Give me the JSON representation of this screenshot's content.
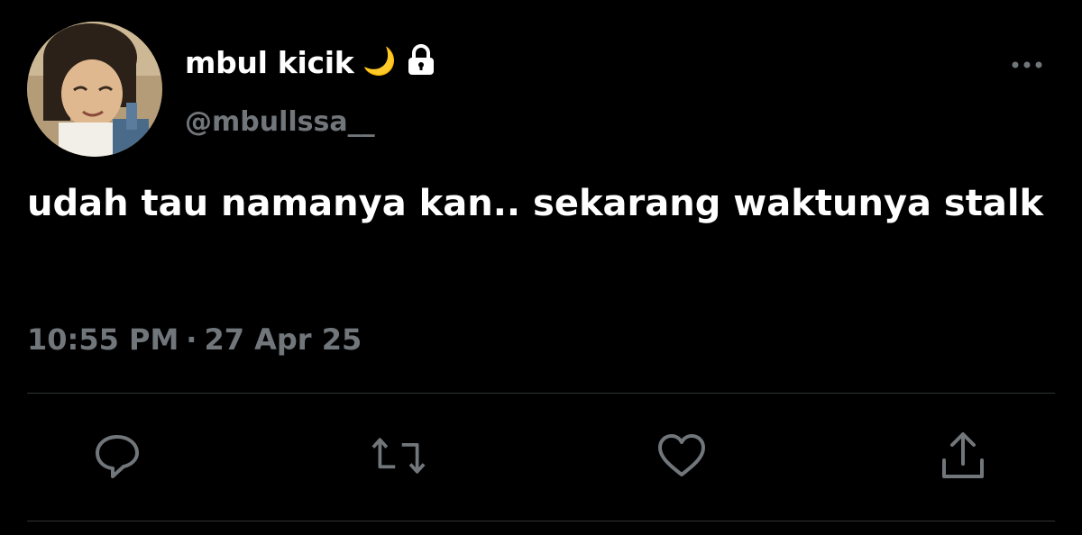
{
  "user": {
    "display_name": "mbul kicik",
    "handle": "@mbullssa__",
    "name_emoji": "🌙",
    "protected_icon": "lock-icon",
    "avatar": "profile-photo"
  },
  "tweet": {
    "text": "udah tau namanya kan.. sekarang waktunya stalk",
    "time": "10:55 PM",
    "separator": "·",
    "date": "27 Apr 25"
  },
  "actions": {
    "icons": [
      "reply-icon",
      "retweet-icon",
      "like-icon",
      "share-icon"
    ]
  },
  "colors": {
    "background": "#000000",
    "primary_text": "#ffffff",
    "secondary_text": "#71767b",
    "divider": "#2f3336"
  }
}
